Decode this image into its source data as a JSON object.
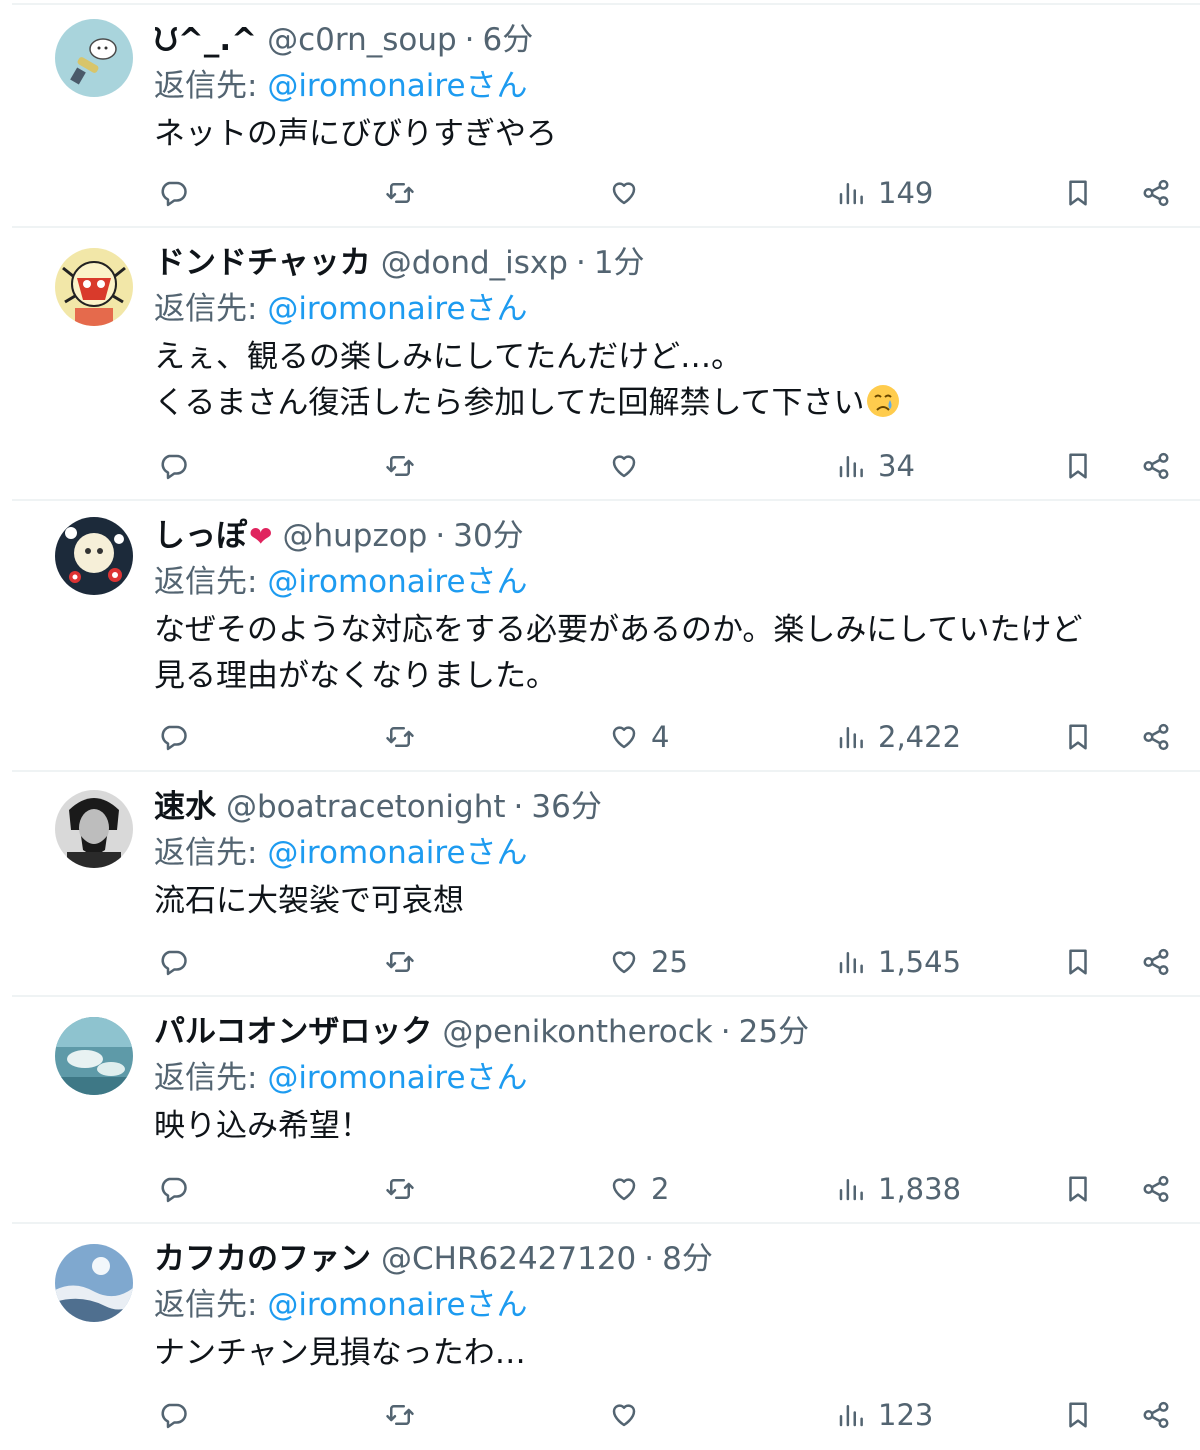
{
  "colors": {
    "text": "#0f1419",
    "muted": "#536471",
    "link": "#1d9bf0",
    "divider": "#eff3f4"
  },
  "icons": [
    "reply-icon",
    "retweet-icon",
    "like-icon",
    "views-icon",
    "bookmark-icon",
    "share-icon"
  ],
  "replies": [
    {
      "name": "ᙀ^_.^",
      "handle": "@c0rn_soup",
      "sep": "·",
      "time": "6分",
      "replying_prefix": "返信先: ",
      "replying_to": "@iromonaireさん",
      "lines": [
        "ネットの声にびびりすぎやろ"
      ],
      "likes": "",
      "views": "149"
    },
    {
      "name": "ドンドチャッカ",
      "handle": "@dond_isxp",
      "sep": "·",
      "time": "1分",
      "replying_prefix": "返信先: ",
      "replying_to": "@iromonaireさん",
      "lines": [
        "えぇ、観るの楽しみにしてたんだけど…。",
        "くるまさん復活したら参加してた回解禁して下さい"
      ],
      "likes": "",
      "views": "34"
    },
    {
      "name": "しっぽ",
      "name_emoji": "❤",
      "handle": "@hupzop",
      "sep": "·",
      "time": "30分",
      "replying_prefix": "返信先: ",
      "replying_to": "@iromonaireさん",
      "lines": [
        "なぜそのような対応をする必要があるのか。楽しみにしていたけど",
        "見る理由がなくなりました。"
      ],
      "likes": "4",
      "views": "2,422"
    },
    {
      "name": "速水",
      "handle": "@boatracetonight",
      "sep": "·",
      "time": "36分",
      "replying_prefix": "返信先: ",
      "replying_to": "@iromonaireさん",
      "lines": [
        "流石に大袈裟で可哀想"
      ],
      "likes": "25",
      "views": "1,545"
    },
    {
      "name": "パルコオンザロック",
      "handle": "@penikontherock",
      "sep": "·",
      "time": "25分",
      "replying_prefix": "返信先: ",
      "replying_to": "@iromonaireさん",
      "lines": [
        "映り込み希望！"
      ],
      "likes": "2",
      "views": "1,838"
    },
    {
      "name": "カフカのファン",
      "handle": "@CHR62427120",
      "sep": "·",
      "time": "8分",
      "replying_prefix": "返信先: ",
      "replying_to": "@iromonaireさん",
      "lines": [
        "ナンチャン見損なったわ…"
      ],
      "likes": "",
      "views": "123"
    }
  ]
}
